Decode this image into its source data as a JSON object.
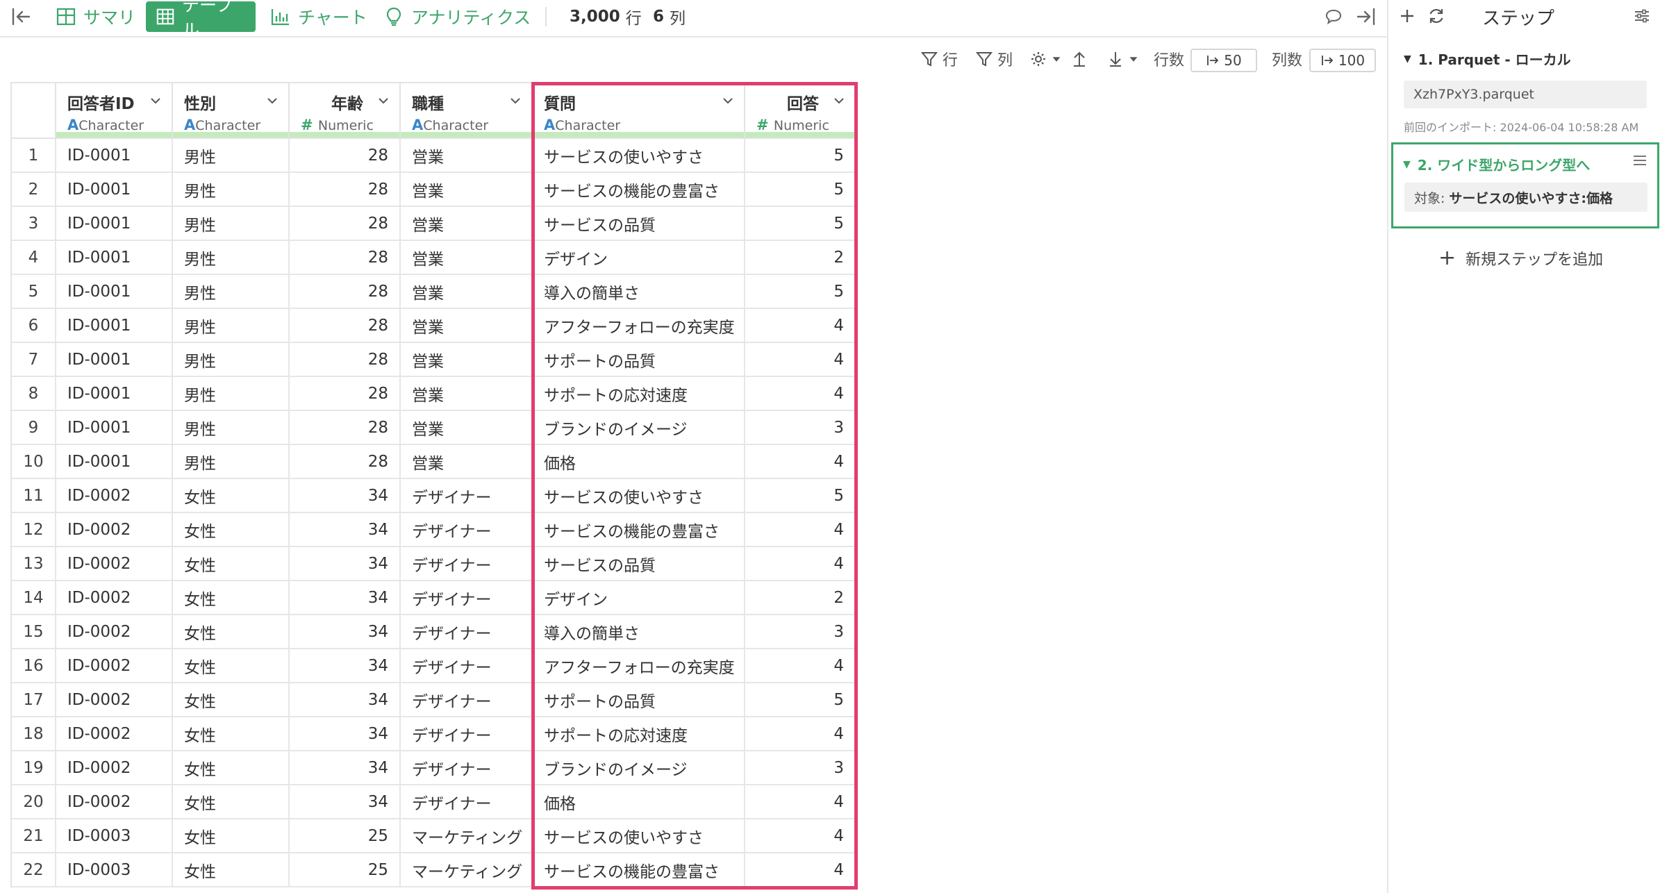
{
  "toolbar": {
    "tabs": [
      {
        "label": "サマリ",
        "icon": "summary-grid-icon"
      },
      {
        "label": "テーブル",
        "icon": "table-grid-icon"
      },
      {
        "label": "チャート",
        "icon": "bar-chart-icon"
      },
      {
        "label": "アナリティクス",
        "icon": "lightbulb-icon"
      }
    ],
    "active_tab": "テーブル",
    "row_count": "3,000",
    "row_unit": "行",
    "col_count": "6",
    "col_unit": "列",
    "accent_color": "#3ca66a"
  },
  "subbar": {
    "row_filter": "行",
    "col_filter": "列",
    "rows_label": "行数",
    "rows_value": "50",
    "cols_label": "列数",
    "cols_value": "100"
  },
  "table": {
    "columns": [
      {
        "name": "回答者ID",
        "type": "Character"
      },
      {
        "name": "性別",
        "type": "Character"
      },
      {
        "name": "年齢",
        "type": "Numeric"
      },
      {
        "name": "職種",
        "type": "Character"
      },
      {
        "name": "質問",
        "type": "Character"
      },
      {
        "name": "回答",
        "type": "Numeric"
      }
    ],
    "rows": [
      [
        "1",
        "ID-0001",
        "男性",
        "28",
        "営業",
        "サービスの使いやすさ",
        "5"
      ],
      [
        "2",
        "ID-0001",
        "男性",
        "28",
        "営業",
        "サービスの機能の豊富さ",
        "5"
      ],
      [
        "3",
        "ID-0001",
        "男性",
        "28",
        "営業",
        "サービスの品質",
        "5"
      ],
      [
        "4",
        "ID-0001",
        "男性",
        "28",
        "営業",
        "デザイン",
        "2"
      ],
      [
        "5",
        "ID-0001",
        "男性",
        "28",
        "営業",
        "導入の簡単さ",
        "5"
      ],
      [
        "6",
        "ID-0001",
        "男性",
        "28",
        "営業",
        "アフターフォローの充実度",
        "4"
      ],
      [
        "7",
        "ID-0001",
        "男性",
        "28",
        "営業",
        "サポートの品質",
        "4"
      ],
      [
        "8",
        "ID-0001",
        "男性",
        "28",
        "営業",
        "サポートの応対速度",
        "4"
      ],
      [
        "9",
        "ID-0001",
        "男性",
        "28",
        "営業",
        "ブランドのイメージ",
        "3"
      ],
      [
        "10",
        "ID-0001",
        "男性",
        "28",
        "営業",
        "価格",
        "4"
      ],
      [
        "11",
        "ID-0002",
        "女性",
        "34",
        "デザイナー",
        "サービスの使いやすさ",
        "5"
      ],
      [
        "12",
        "ID-0002",
        "女性",
        "34",
        "デザイナー",
        "サービスの機能の豊富さ",
        "4"
      ],
      [
        "13",
        "ID-0002",
        "女性",
        "34",
        "デザイナー",
        "サービスの品質",
        "4"
      ],
      [
        "14",
        "ID-0002",
        "女性",
        "34",
        "デザイナー",
        "デザイン",
        "2"
      ],
      [
        "15",
        "ID-0002",
        "女性",
        "34",
        "デザイナー",
        "導入の簡単さ",
        "3"
      ],
      [
        "16",
        "ID-0002",
        "女性",
        "34",
        "デザイナー",
        "アフターフォローの充実度",
        "4"
      ],
      [
        "17",
        "ID-0002",
        "女性",
        "34",
        "デザイナー",
        "サポートの品質",
        "5"
      ],
      [
        "18",
        "ID-0002",
        "女性",
        "34",
        "デザイナー",
        "サポートの応対速度",
        "4"
      ],
      [
        "19",
        "ID-0002",
        "女性",
        "34",
        "デザイナー",
        "ブランドのイメージ",
        "3"
      ],
      [
        "20",
        "ID-0002",
        "女性",
        "34",
        "デザイナー",
        "価格",
        "4"
      ],
      [
        "21",
        "ID-0003",
        "女性",
        "25",
        "マーケティング",
        "サービスの使いやすさ",
        "4"
      ],
      [
        "22",
        "ID-0003",
        "女性",
        "25",
        "マーケティング",
        "サービスの機能の豊富さ",
        "4"
      ]
    ],
    "highlight_color": "#e23d6f"
  },
  "panel": {
    "title": "ステップ",
    "step1": {
      "title": "1. Parquet - ローカル",
      "file": "Xzh7PxY3.parquet",
      "import_note": "前回のインポート: 2024-06-04 10:58:28 AM"
    },
    "step2": {
      "title": "2. ワイド型からロング型へ",
      "cond_label": "対象:",
      "cond_value": "サービスの使いやすさ:価格"
    },
    "add_step": "新規ステップを追加"
  }
}
